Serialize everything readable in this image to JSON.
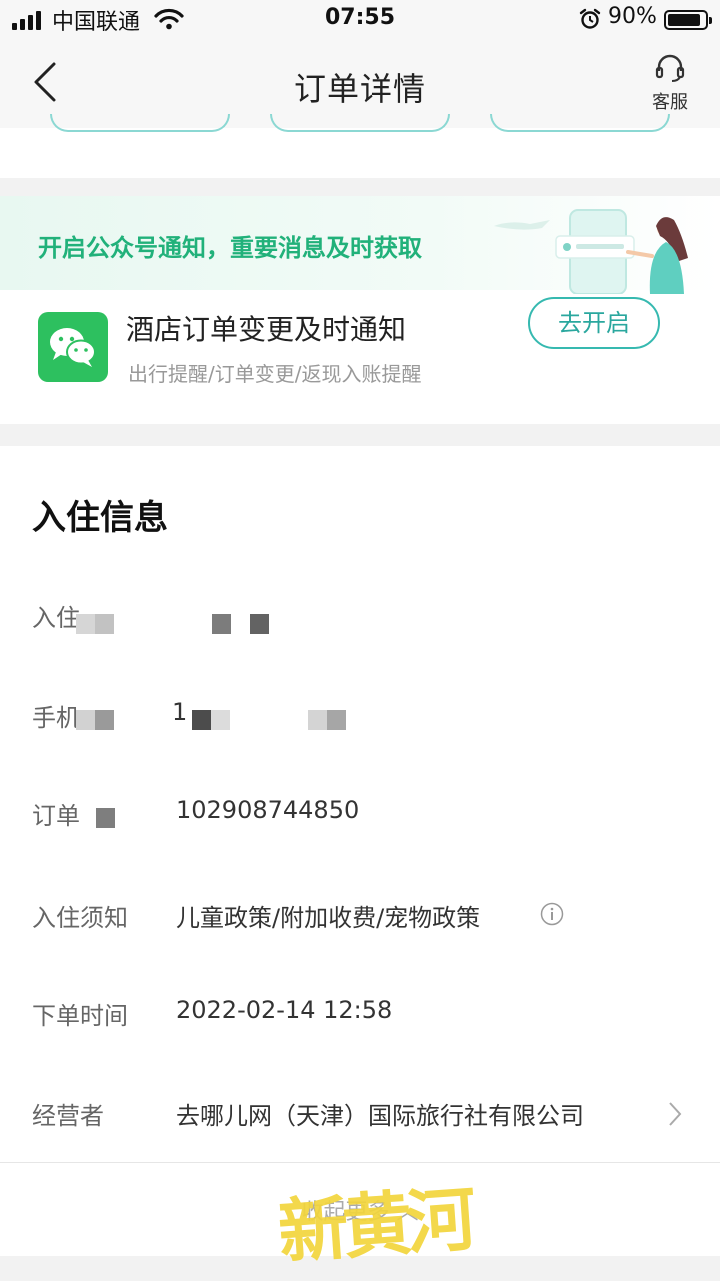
{
  "status_bar": {
    "carrier": "中国联通",
    "time": "07:55",
    "battery_percent": "90%",
    "battery_level": 0.9,
    "icons": [
      "signal-icon",
      "wifi-icon",
      "alarm-icon",
      "battery-icon"
    ]
  },
  "nav": {
    "title": "订单详情",
    "service_label": "客服",
    "icons": [
      "back-arrow-icon",
      "headset-icon"
    ]
  },
  "notify": {
    "headline": "开启公众号通知，重要消息及时获取",
    "title": "酒店订单变更及时通知",
    "subtitle": "出行提醒/订单变更/返现入账提醒",
    "button": "去开启",
    "accent_color": "#21b17a",
    "button_color": "#36b9b0",
    "icon": "wechat-icon"
  },
  "checkin": {
    "title": "入住信息",
    "rows": [
      {
        "label": "入住",
        "value": ""
      },
      {
        "label": "手机",
        "value": "1"
      },
      {
        "label": "订单",
        "value": "102908744850"
      },
      {
        "label": "入住须知",
        "value": "儿童政策/附加收费/宠物政策"
      },
      {
        "label": "下单时间",
        "value": "2022-02-14 12:58"
      },
      {
        "label": "经营者",
        "value": "去哪儿网（天津）国际旅行社有限公司"
      }
    ],
    "collapse_label": "收起更多"
  },
  "watermark": "新黄河"
}
